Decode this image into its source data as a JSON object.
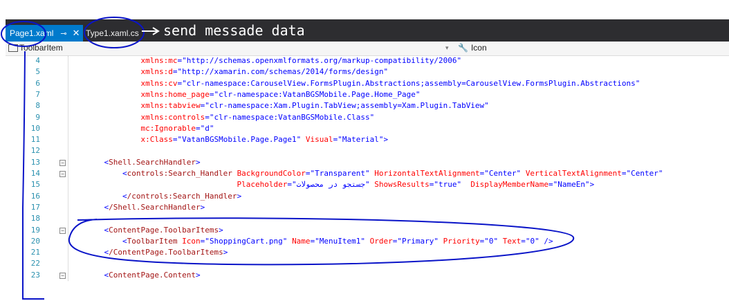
{
  "tabs": [
    {
      "label": "Page1.xaml",
      "active": true,
      "pin_glyph": "⊸",
      "close_glyph": "✕"
    },
    {
      "label": "Type1.xaml.cs",
      "active": false
    }
  ],
  "annotation": "send messade data",
  "navbar": {
    "left_label": "ToolbarItem",
    "right_label": "Icon"
  },
  "lines": [
    {
      "num": "4",
      "code": "            xmlns:mc=\"http://schemas.openxmlformats.org/markup-compatibility/2006\""
    },
    {
      "num": "5",
      "code": "            xmlns:d=\"http://xamarin.com/schemas/2014/forms/design\""
    },
    {
      "num": "6",
      "code": "            xmlns:cv=\"clr-namespace:CarouselView.FormsPlugin.Abstractions;assembly=CarouselView.FormsPlugin.Abstractions\""
    },
    {
      "num": "7",
      "code": "            xmlns:home_page=\"clr-namespace:VatanBGSMobile.Page.Home_Page\""
    },
    {
      "num": "8",
      "code": "            xmlns:tabview=\"clr-namespace:Xam.Plugin.TabView;assembly=Xam.Plugin.TabView\""
    },
    {
      "num": "9",
      "code": "            xmlns:controls=\"clr-namespace:VatanBGSMobile.Class\""
    },
    {
      "num": "10",
      "code": "            mc:Ignorable=\"d\""
    },
    {
      "num": "11",
      "code": "            x:Class=\"VatanBGSMobile.Page.Page1\" Visual=\"Material\">"
    },
    {
      "num": "12",
      "code": ""
    },
    {
      "num": "13",
      "code": "    <Shell.SearchHandler>"
    },
    {
      "num": "14",
      "code": "        <controls:Search_Handler BackgroundColor=\"Transparent\" HorizontalTextAlignment=\"Center\" VerticalTextAlignment=\"Center\""
    },
    {
      "num": "15",
      "code": "                                 Placeholder=\"جستجو در محصولات\" ShowsResults=\"true\"  DisplayMemberName=\"NameEn\">"
    },
    {
      "num": "16",
      "code": "        </controls:Search_Handler>"
    },
    {
      "num": "17",
      "code": "    </Shell.SearchHandler>"
    },
    {
      "num": "18",
      "code": ""
    },
    {
      "num": "19",
      "code": "    <ContentPage.ToolbarItems>"
    },
    {
      "num": "20",
      "code": "        <ToolbarItem Icon=\"ShoppingCart.png\" Name=\"MenuItem1\" Order=\"Primary\" Priority=\"0\" Text=\"0\" />"
    },
    {
      "num": "21",
      "code": "    </ContentPage.ToolbarItems>"
    },
    {
      "num": "22",
      "code": ""
    },
    {
      "num": "23",
      "code": "    <ContentPage.Content>"
    }
  ],
  "fold_lines": [
    "13",
    "14",
    "19",
    "23"
  ],
  "colors": {
    "tab_active": "#007acc",
    "line_number": "#2b91af",
    "tag": "#a31515",
    "attribute": "#ff0000",
    "value": "#0000ff",
    "ink": "#0a14c8"
  }
}
